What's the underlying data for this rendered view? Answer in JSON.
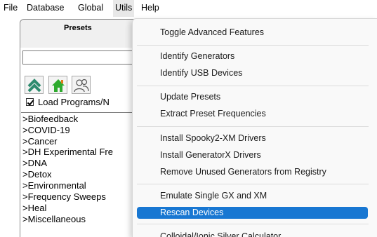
{
  "menubar": {
    "items": [
      "File",
      "Database",
      "Global",
      "Utils",
      "Help"
    ],
    "active_index": 3
  },
  "presets": {
    "title": "Presets",
    "search_value": "",
    "load_programs_label": "Load Programs/N",
    "load_programs_checked": true,
    "list_items": [
      ">Biofeedback",
      ">COVID-19",
      ">Cancer",
      ">DH Experimental Fre",
      ">DNA",
      ">Detox",
      ">Environmental",
      ">Frequency Sweeps",
      ">Heal",
      ">Miscellaneous"
    ]
  },
  "utils_menu": {
    "items": [
      "Toggle Advanced Features",
      "Identify Generators",
      "Identify USB Devices",
      "Update Presets",
      "Extract Preset Frequencies",
      "Install Spooky2-XM Drivers",
      "Install GeneratorX Drivers",
      "Remove Unused Generators from Registry",
      "Emulate Single GX and XM",
      "Rescan Devices",
      "Colloidal/Ionic Silver Calculator"
    ],
    "highlighted": "Rescan Devices"
  },
  "colors": {
    "highlight": "#1877d2",
    "toolbar_arrow": "#2e8b6e",
    "home_icon": "#2eaa2e"
  },
  "icons": [
    "up-arrows-icon",
    "home-icon",
    "people-icon",
    "checkmark-icon"
  ]
}
